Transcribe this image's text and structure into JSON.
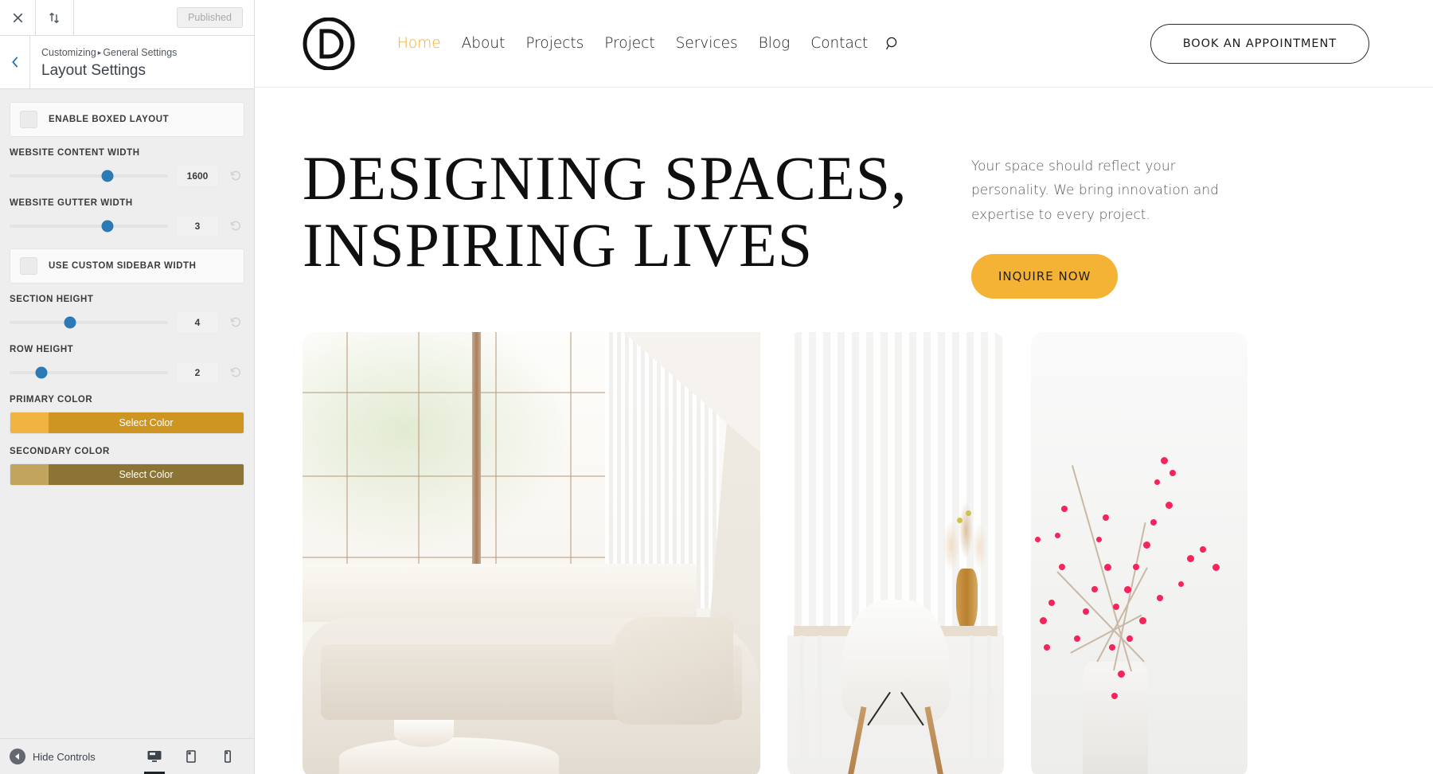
{
  "customizer": {
    "topbar": {
      "close_icon": "close-icon",
      "devices_icon": "collapse-expand-icon",
      "publish_label": "Published"
    },
    "header": {
      "back_icon": "chevron-left-icon",
      "breadcrumb_root": "Customizing",
      "breadcrumb_separator": "▸",
      "breadcrumb_section": "General Settings",
      "panel_title": "Layout Settings"
    },
    "controls": [
      {
        "type": "toggle",
        "label": "ENABLE BOXED LAYOUT",
        "checked": false
      },
      {
        "type": "slider",
        "label": "WEBSITE CONTENT WIDTH",
        "value": "1600",
        "percent": 62
      },
      {
        "type": "slider",
        "label": "WEBSITE GUTTER WIDTH",
        "value": "3",
        "percent": 62
      },
      {
        "type": "toggle",
        "label": "USE CUSTOM SIDEBAR WIDTH",
        "checked": false
      },
      {
        "type": "slider",
        "label": "SECTION HEIGHT",
        "value": "4",
        "percent": 38
      },
      {
        "type": "slider",
        "label": "ROW HEIGHT",
        "value": "2",
        "percent": 20
      }
    ],
    "colors": [
      {
        "label": "PRIMARY COLOR",
        "button_label": "Select Color",
        "swatch": "#f2b440",
        "fill": "#cf9521"
      },
      {
        "label": "SECONDARY COLOR",
        "button_label": "Select Color",
        "swatch": "#c2a45f",
        "fill": "#8c7436"
      }
    ],
    "reset_icon": "reset-arrow-icon",
    "footer": {
      "hide_controls_label": "Hide Controls",
      "hide_icon": "caret-left-icon",
      "devices": [
        {
          "name": "desktop",
          "icon": "desktop-icon",
          "active": true
        },
        {
          "name": "tablet",
          "icon": "tablet-icon",
          "active": false
        },
        {
          "name": "mobile",
          "icon": "mobile-icon",
          "active": false
        }
      ]
    }
  },
  "site": {
    "logo_letter": "D",
    "nav": [
      {
        "label": "Home",
        "active": true
      },
      {
        "label": "About",
        "active": false
      },
      {
        "label": "Projects",
        "active": false
      },
      {
        "label": "Project",
        "active": false
      },
      {
        "label": "Services",
        "active": false
      },
      {
        "label": "Blog",
        "active": false
      },
      {
        "label": "Contact",
        "active": false
      }
    ],
    "search_icon": "search-icon",
    "book_button": "BOOK AN APPOINTMENT",
    "hero": {
      "title_line1": "DESIGNING SPACES,",
      "title_line2": "INSPIRING LIVES",
      "paragraph": "Your space should reflect your personality. We bring innovation and expertise to every project.",
      "cta_label": "INQUIRE NOW"
    },
    "gallery": [
      {
        "name": "interior-window-sofa"
      },
      {
        "name": "white-chair-desk-vase"
      },
      {
        "name": "red-berry-branches"
      }
    ]
  },
  "theme": {
    "accent": "#f0ad2e",
    "cta_bg": "#f5b335",
    "slider_thumb": "#2b7ab5",
    "link_blue": "#2271b1"
  }
}
